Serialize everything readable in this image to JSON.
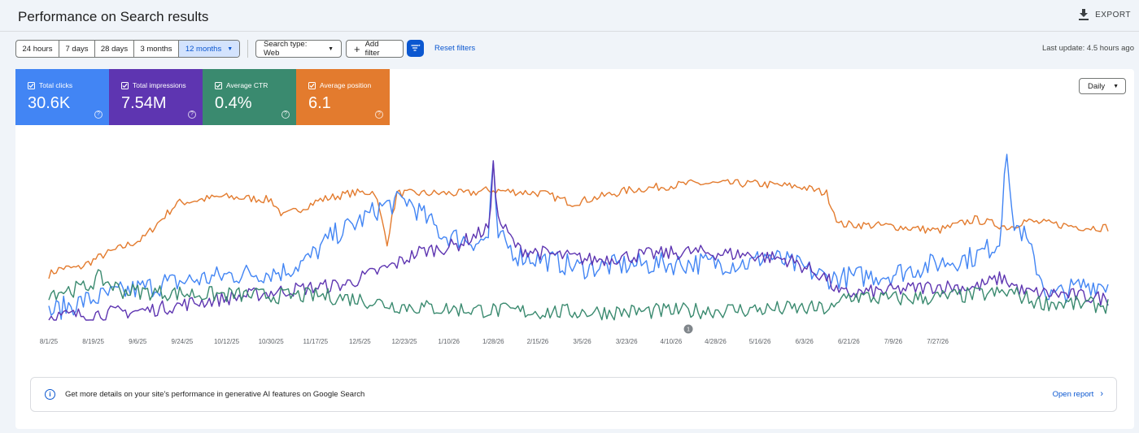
{
  "header": {
    "title": "Performance on Search results",
    "export_label": "EXPORT"
  },
  "filters": {
    "ranges": [
      "24 hours",
      "7 days",
      "28 days",
      "3 months",
      "12 months"
    ],
    "active_range": "12 months",
    "search_type": "Search type: Web",
    "add_filter": "Add filter",
    "reset": "Reset filters",
    "last_update": "Last update: 4.5 hours ago"
  },
  "metrics": [
    {
      "label": "Total clicks",
      "value": "30.6K",
      "color": "#4285f4",
      "checked": true
    },
    {
      "label": "Total impressions",
      "value": "7.54M",
      "color": "#5e35b1",
      "checked": true
    },
    {
      "label": "Average CTR",
      "value": "0.4%",
      "color": "#3a8a6f",
      "checked": true
    },
    {
      "label": "Average position",
      "value": "6.1",
      "color": "#e37b2e",
      "checked": true
    }
  ],
  "granularity": "Daily",
  "chart_data": {
    "type": "line",
    "x_tick_labels": [
      "8/1/25",
      "8/19/25",
      "9/6/25",
      "9/24/25",
      "10/12/25",
      "10/30/25",
      "11/17/25",
      "12/5/25",
      "12/23/25",
      "1/10/26",
      "1/28/26",
      "2/15/26",
      "3/5/26",
      "3/23/26",
      "4/10/26",
      "4/28/26",
      "5/16/26",
      "6/3/26",
      "6/21/26",
      "7/9/26",
      "7/27/26"
    ],
    "axes_visible": false,
    "grid": false,
    "annotation": {
      "label": "1",
      "date": "4/17/26"
    },
    "series": [
      {
        "metric": "Average position",
        "color": "#e37b2e",
        "trend": [
          [
            0,
            0.26
          ],
          [
            5,
            0.3
          ],
          [
            12,
            0.3
          ],
          [
            22,
            0.38
          ],
          [
            38,
            0.48
          ],
          [
            52,
            0.7
          ],
          [
            70,
            0.74
          ],
          [
            90,
            0.72
          ],
          [
            95,
            0.62
          ],
          [
            110,
            0.72
          ],
          [
            122,
            0.76
          ],
          [
            132,
            0.77
          ],
          [
            137,
            0.46
          ],
          [
            141,
            0.76
          ],
          [
            170,
            0.76
          ],
          [
            178,
            0.78
          ],
          [
            200,
            0.76
          ],
          [
            212,
            0.7
          ],
          [
            235,
            0.78
          ],
          [
            260,
            0.82
          ],
          [
            285,
            0.82
          ],
          [
            305,
            0.8
          ],
          [
            315,
            0.76
          ],
          [
            320,
            0.57
          ],
          [
            340,
            0.56
          ],
          [
            360,
            0.53
          ],
          [
            375,
            0.6
          ],
          [
            389,
            0.55
          ],
          [
            395,
            0.59
          ],
          [
            420,
            0.55
          ],
          [
            429,
            0.55
          ]
        ],
        "noise": 0.025
      },
      {
        "metric": "Total clicks",
        "color": "#4285f4",
        "trend": [
          [
            0,
            0.03
          ],
          [
            15,
            0.1
          ],
          [
            35,
            0.17
          ],
          [
            55,
            0.22
          ],
          [
            75,
            0.26
          ],
          [
            95,
            0.28
          ],
          [
            105,
            0.35
          ],
          [
            115,
            0.5
          ],
          [
            125,
            0.58
          ],
          [
            135,
            0.68
          ],
          [
            145,
            0.72
          ],
          [
            160,
            0.5
          ],
          [
            175,
            0.46
          ],
          [
            180,
            0.52
          ],
          [
            190,
            0.38
          ],
          [
            205,
            0.34
          ],
          [
            215,
            0.3
          ],
          [
            235,
            0.32
          ],
          [
            260,
            0.33
          ],
          [
            285,
            0.33
          ],
          [
            290,
            0.38
          ],
          [
            302,
            0.32
          ],
          [
            315,
            0.24
          ],
          [
            320,
            0.24
          ],
          [
            340,
            0.26
          ],
          [
            360,
            0.33
          ],
          [
            375,
            0.37
          ],
          [
            385,
            0.46
          ],
          [
            389,
            0.62
          ],
          [
            395,
            0.5
          ],
          [
            405,
            0.12
          ],
          [
            420,
            0.2
          ],
          [
            429,
            0.2
          ]
        ],
        "noise": 0.07,
        "spikes": [
          [
            47,
            0.26
          ],
          [
            179,
            0.78
          ],
          [
            180,
            0.96
          ],
          [
            181,
            0.7
          ],
          [
            386,
            0.6
          ],
          [
            387,
            0.88
          ],
          [
            388,
            1.0
          ],
          [
            389,
            0.82
          ]
        ]
      },
      {
        "metric": "Total impressions",
        "color": "#5e35b1",
        "trend": [
          [
            0,
            0.0
          ],
          [
            20,
            0.02
          ],
          [
            40,
            0.04
          ],
          [
            60,
            0.09
          ],
          [
            80,
            0.13
          ],
          [
            100,
            0.17
          ],
          [
            120,
            0.2
          ],
          [
            140,
            0.32
          ],
          [
            150,
            0.4
          ],
          [
            165,
            0.44
          ],
          [
            175,
            0.52
          ],
          [
            182,
            0.6
          ],
          [
            190,
            0.42
          ],
          [
            205,
            0.38
          ],
          [
            220,
            0.35
          ],
          [
            240,
            0.38
          ],
          [
            260,
            0.4
          ],
          [
            285,
            0.38
          ],
          [
            300,
            0.35
          ],
          [
            315,
            0.24
          ],
          [
            320,
            0.14
          ],
          [
            340,
            0.16
          ],
          [
            360,
            0.19
          ],
          [
            375,
            0.18
          ],
          [
            386,
            0.24
          ],
          [
            395,
            0.15
          ],
          [
            410,
            0.14
          ],
          [
            429,
            0.11
          ]
        ],
        "noise": 0.045,
        "spikes": [
          [
            179,
            0.68
          ],
          [
            180,
            0.96
          ],
          [
            181,
            0.74
          ],
          [
            182,
            0.62
          ]
        ]
      },
      {
        "metric": "Average CTR",
        "color": "#3a8a6f",
        "trend": [
          [
            0,
            0.15
          ],
          [
            15,
            0.18
          ],
          [
            20,
            0.24
          ],
          [
            30,
            0.16
          ],
          [
            60,
            0.14
          ],
          [
            90,
            0.13
          ],
          [
            110,
            0.13
          ],
          [
            125,
            0.11
          ],
          [
            140,
            0.07
          ],
          [
            160,
            0.05
          ],
          [
            200,
            0.03
          ],
          [
            230,
            0.03
          ],
          [
            270,
            0.04
          ],
          [
            300,
            0.05
          ],
          [
            319,
            0.05
          ],
          [
            322,
            0.13
          ],
          [
            340,
            0.11
          ],
          [
            360,
            0.12
          ],
          [
            390,
            0.15
          ],
          [
            400,
            0.09
          ],
          [
            429,
            0.07
          ]
        ],
        "noise": 0.05
      }
    ]
  },
  "banner": {
    "text": "Get more details on your site's performance in generative AI features on Google Search",
    "link": "Open report"
  }
}
